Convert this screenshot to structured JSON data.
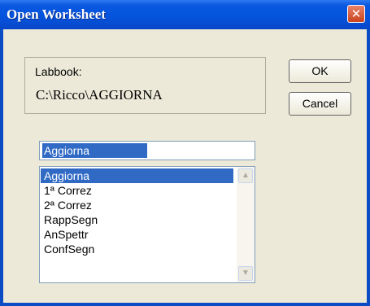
{
  "window": {
    "title": "Open Worksheet",
    "close_glyph": "✕"
  },
  "labbook": {
    "label": "Labbook:",
    "path": "C:\\Ricco\\AGGIORNA"
  },
  "buttons": {
    "ok": "OK",
    "cancel": "Cancel"
  },
  "input": {
    "value": "Aggiorna"
  },
  "list": {
    "items": [
      "Aggiorna",
      "1ª Correz",
      "2ª Correz",
      "RappSegn",
      "AnSpettr",
      "ConfSegn"
    ],
    "selected": 0
  },
  "scrollbar": {
    "up_icon": "chevron-up-icon",
    "down_icon": "chevron-down-icon"
  }
}
